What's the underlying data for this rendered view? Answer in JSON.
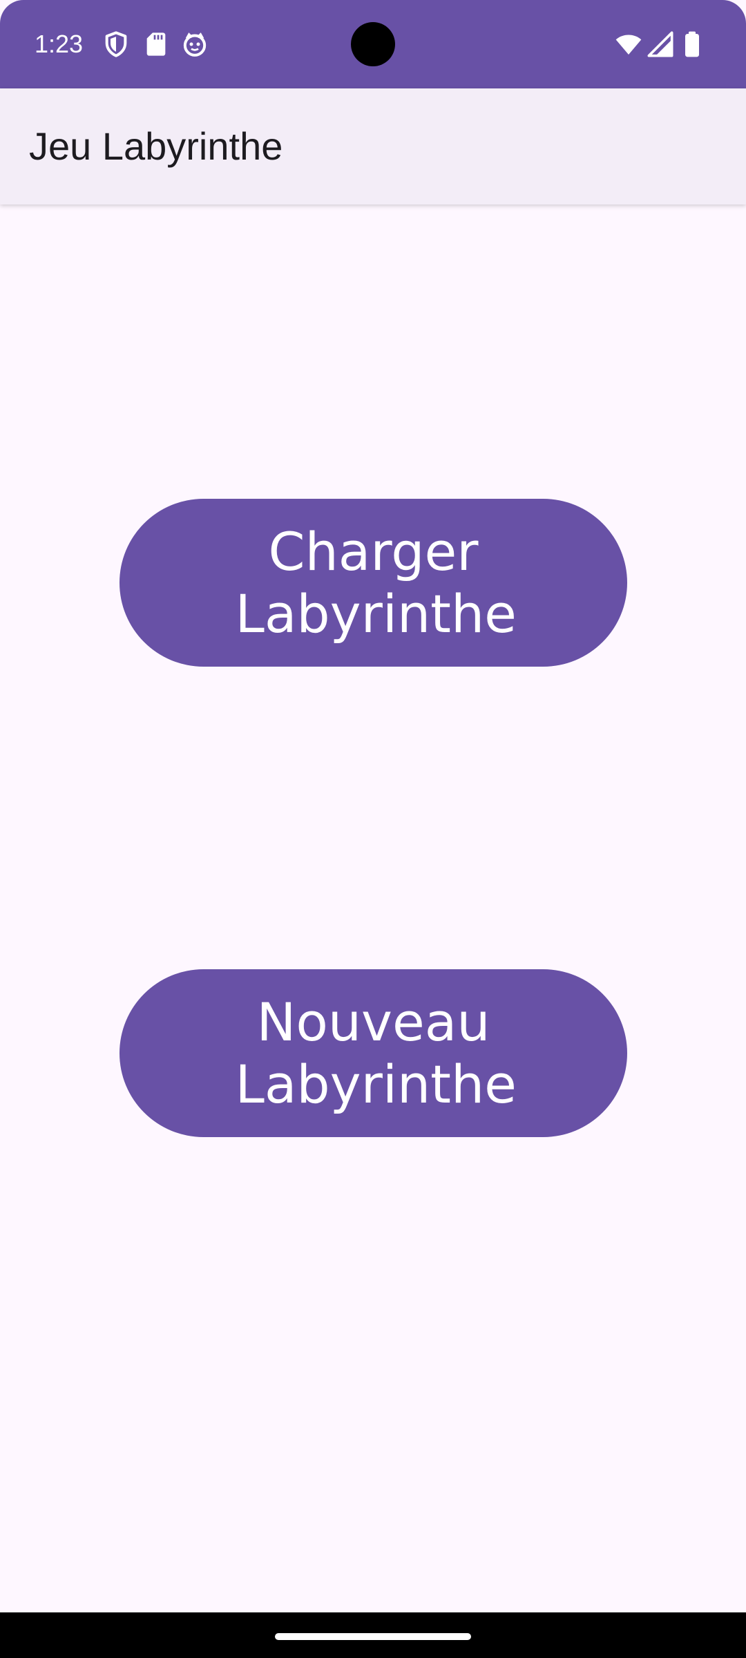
{
  "status_bar": {
    "time": "1:23",
    "left_icons": [
      "shield-icon",
      "sd-card-icon",
      "face-icon"
    ],
    "right_icons": [
      "wifi-icon",
      "signal-icon",
      "battery-icon"
    ],
    "color": "#6851A6"
  },
  "app_bar": {
    "title": "Jeu Labyrinthe"
  },
  "main": {
    "buttons": [
      {
        "label": "Charger Labyrinthe"
      },
      {
        "label": "Nouveau Labyrinthe"
      }
    ]
  },
  "colors": {
    "primary": "#6851A6",
    "background": "#FEF7FF",
    "app_bar": "#F3EDF7",
    "on_primary": "#FFFFFF"
  }
}
